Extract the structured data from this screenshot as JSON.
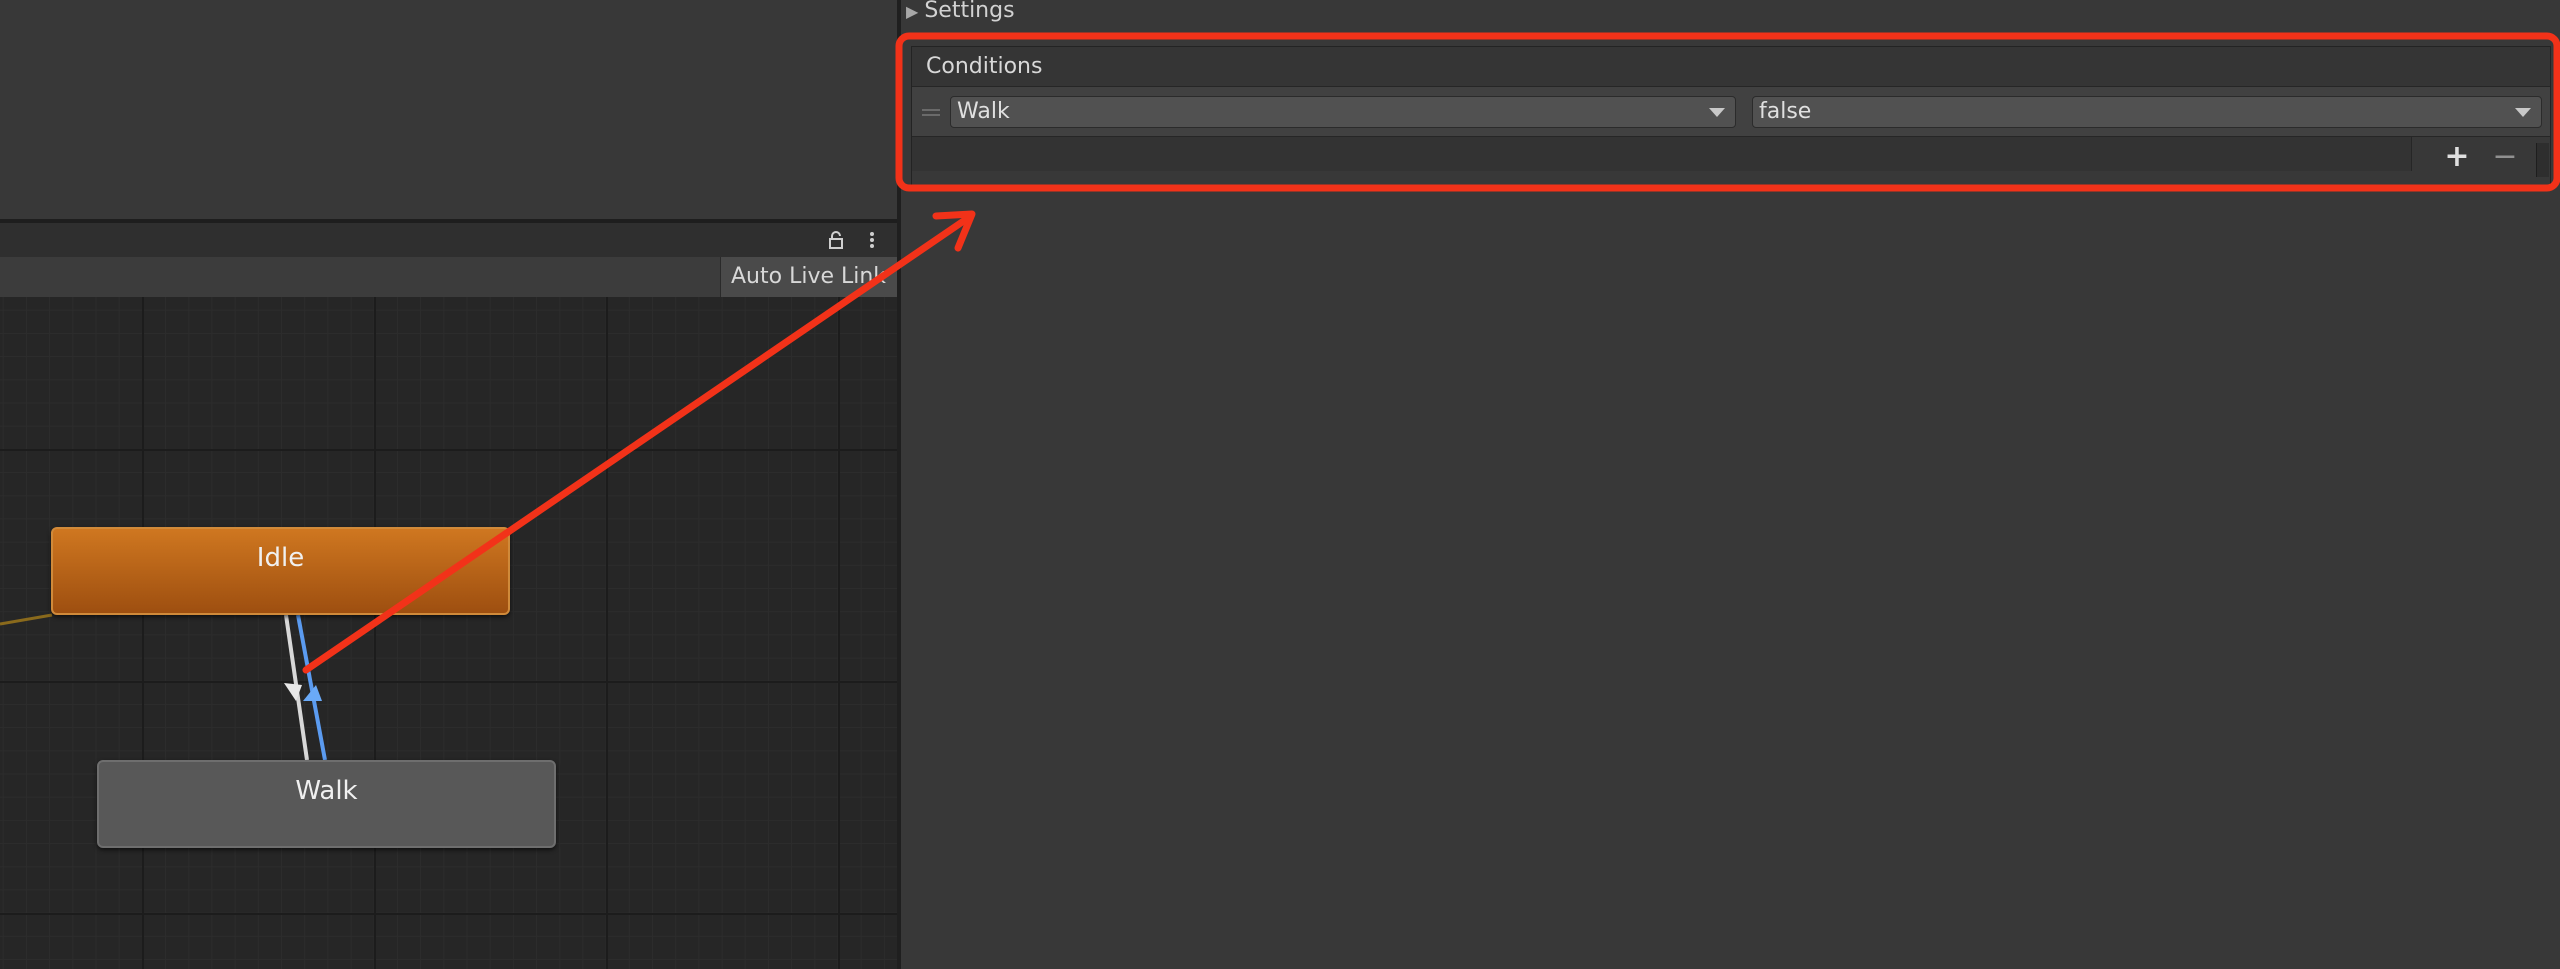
{
  "inspector": {
    "settings_label": "Settings",
    "conditions": {
      "header": "Conditions",
      "rows": [
        {
          "parameter": "Walk",
          "value": "false"
        }
      ],
      "add_label": "+",
      "remove_label": "−"
    }
  },
  "animator": {
    "auto_live_link_label": "Auto Live Link",
    "states": {
      "idle": "Idle",
      "walk": "Walk"
    }
  },
  "icons": {
    "lock": "lock-icon",
    "more": "more-vertical-icon",
    "settings_arrow": "triangle-right-icon",
    "drag": "drag-handle-icon",
    "dropdown": "caret-down-icon"
  },
  "colors": {
    "idle_state": "#c46b1b",
    "walk_state": "#585858",
    "annotation": "#f23219",
    "transition_active": "#5b9bf0",
    "transition": "#d8d8d8"
  }
}
